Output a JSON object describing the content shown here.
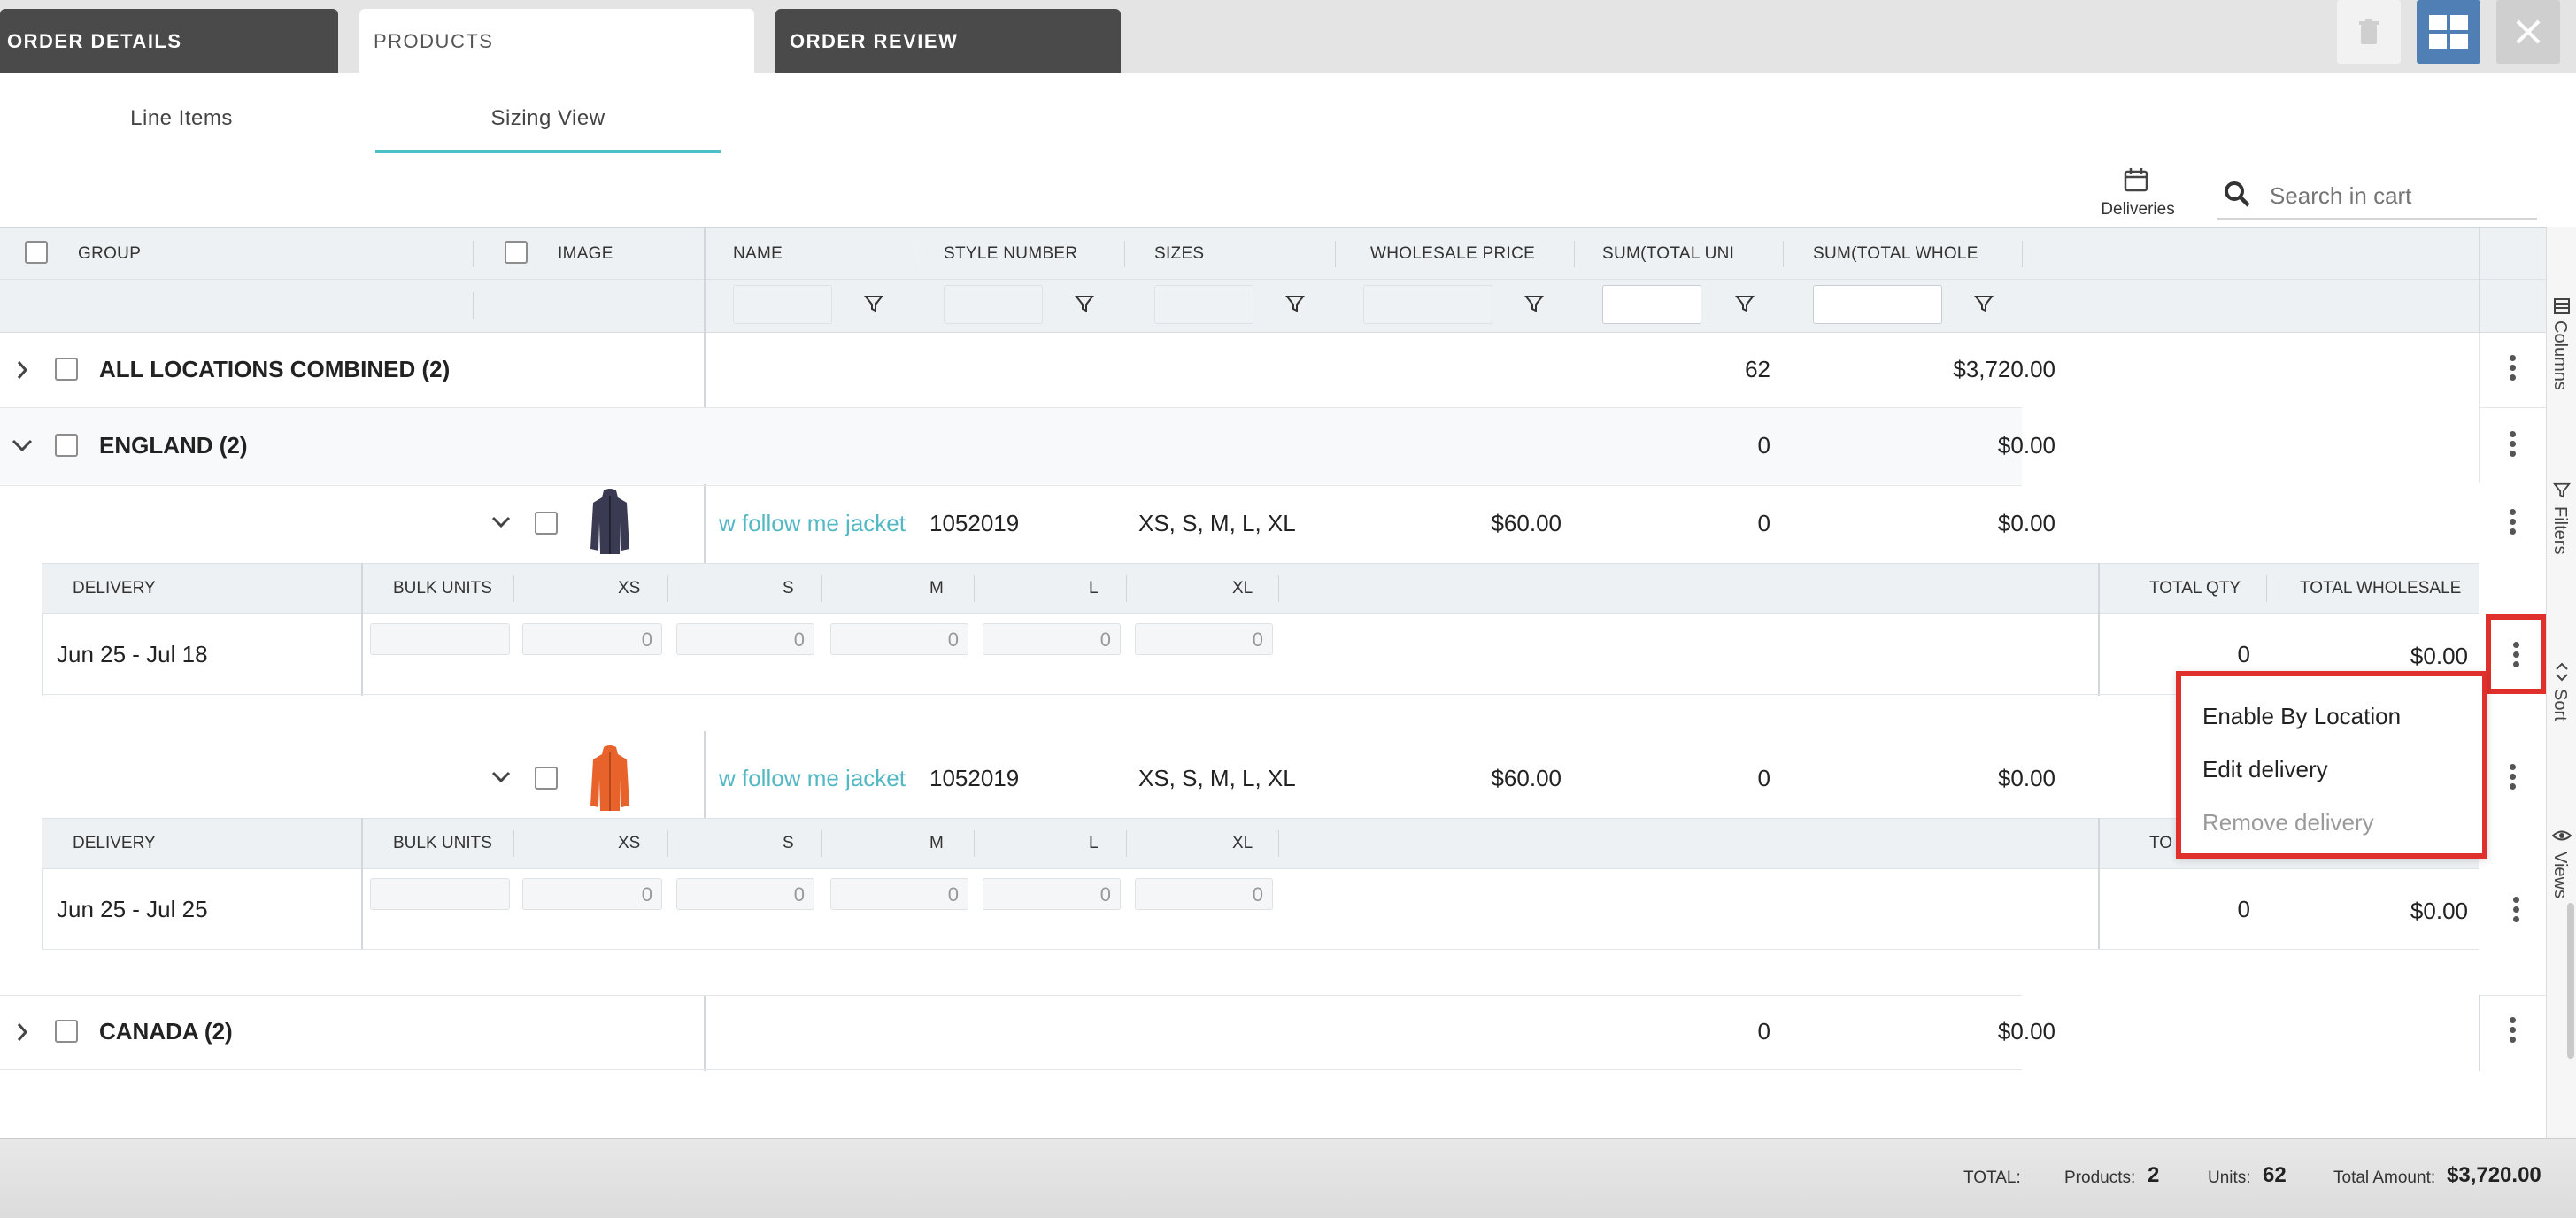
{
  "top_tabs": [
    {
      "label": "ORDER DETAILS"
    },
    {
      "label": "PRODUCTS"
    },
    {
      "label": "ORDER REVIEW"
    }
  ],
  "sub_tabs": [
    {
      "label": "Line Items"
    },
    {
      "label": "Sizing View"
    }
  ],
  "toolbar": {
    "deliveries_label": "Deliveries",
    "search_placeholder": "Search in cart"
  },
  "grid": {
    "columns": [
      "GROUP",
      "IMAGE",
      "NAME",
      "STYLE NUMBER",
      "SIZES",
      "WHOLESALE PRICE",
      "SUM(TOTAL UNI",
      "SUM(TOTAL WHOLE"
    ],
    "groups": [
      {
        "label": "ALL LOCATIONS COMBINED (2)",
        "units": "62",
        "wholesale": "$3,720.00"
      },
      {
        "label": "ENGLAND (2)",
        "units": "0",
        "wholesale": "$0.00"
      },
      {
        "label": "CANADA (2)",
        "units": "0",
        "wholesale": "$0.00"
      }
    ],
    "products": [
      {
        "name": "w follow me jacket",
        "style": "1052019",
        "sizes": "XS, S, M, L, XL",
        "price": "$60.00",
        "units": "0",
        "wholesale": "$0.00",
        "image": "navy-jacket",
        "delivery": "Jun 25 - Jul 18",
        "total_qty": "0",
        "total_wholesale": "$0.00"
      },
      {
        "name": "w follow me jacket",
        "style": "1052019",
        "sizes": "XS, S, M, L, XL",
        "price": "$60.00",
        "units": "0",
        "wholesale": "$0.00",
        "image": "orange-jacket",
        "delivery": "Jun 25 - Jul 25",
        "total_qty": "0",
        "total_wholesale": "$0.00"
      }
    ],
    "sub_columns": [
      "DELIVERY",
      "BULK UNITS",
      "XS",
      "S",
      "M",
      "L",
      "XL",
      "TOTAL QTY",
      "TOTAL WHOLESALE"
    ],
    "sub_columns_partial": [
      "DELIVERY",
      "BULK UNITS",
      "XS",
      "S",
      "M",
      "L",
      "XL",
      "TO"
    ],
    "size_placeholder": "0"
  },
  "context_menu": {
    "items": [
      {
        "label": "Enable By Location",
        "disabled": false
      },
      {
        "label": "Edit delivery",
        "disabled": false
      },
      {
        "label": "Remove delivery",
        "disabled": true
      }
    ]
  },
  "side_panel": [
    "Columns",
    "Filters",
    "Sort",
    "Views"
  ],
  "footer": {
    "total_label": "TOTAL:",
    "products_label": "Products:",
    "products_value": "2",
    "units_label": "Units:",
    "units_value": "62",
    "amount_label": "Total Amount:",
    "amount_value": "$3,720.00"
  },
  "colors": {
    "accent": "#52b8c4",
    "tab_dark": "#4a4a4a",
    "highlight": "#e0302b",
    "grid_button": "#4f7fb5"
  }
}
